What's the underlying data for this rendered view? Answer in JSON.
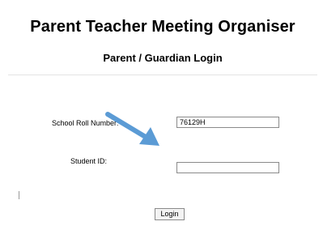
{
  "header": {
    "app_title": "Parent Teacher Meeting Organiser",
    "sub_title": "Parent / Guardian Login"
  },
  "form": {
    "roll_label": "School Roll Number:",
    "roll_value": "76129H",
    "student_id_label": "Student ID:",
    "student_id_value": "",
    "login_label": "Login"
  },
  "annotation": {
    "arrow_icon": "arrow-down-right-icon",
    "arrow_color": "#5b9bd5"
  }
}
